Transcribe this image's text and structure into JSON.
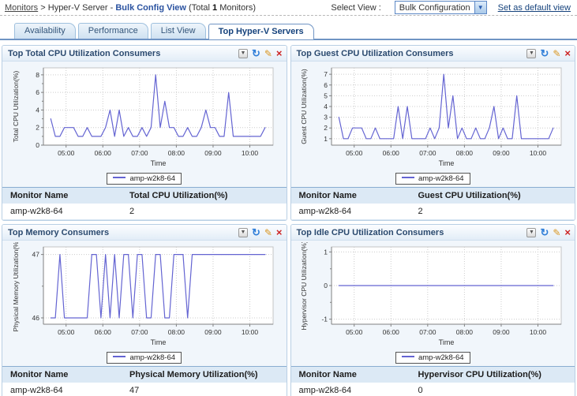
{
  "page": {
    "breadcrumb": {
      "link": "Monitors",
      "separator": ">",
      "context": "Hyper-V Server -",
      "view_name": "Bulk Config View",
      "total_prefix": "(Total",
      "total_count": "1",
      "total_suffix": "Monitors)"
    },
    "select_view_label": "Select View :",
    "select_view_value": "Bulk Configuration",
    "select_arrow": "▼",
    "set_default_link": "Set as default view"
  },
  "tabs": [
    {
      "label": "Availability",
      "active": false
    },
    {
      "label": "Performance",
      "active": false
    },
    {
      "label": "List View",
      "active": false
    },
    {
      "label": "Top Hyper-V Servers",
      "active": true
    }
  ],
  "panel_icons": {
    "minimize": "▼",
    "refresh": "↻",
    "edit": "✎",
    "close": "×"
  },
  "panels": [
    {
      "title": "Top Total CPU Utilization Consumers",
      "table": {
        "col1": "Monitor Name",
        "col2": "Total CPU Utilization(%)",
        "rows": [
          {
            "name": "amp-w2k8-64",
            "value": "2"
          }
        ]
      }
    },
    {
      "title": "Top Guest CPU Utilization Consumers",
      "table": {
        "col1": "Monitor Name",
        "col2": "Guest CPU Utilization(%)",
        "rows": [
          {
            "name": "amp-w2k8-64",
            "value": "2"
          }
        ]
      }
    },
    {
      "title": "Top Memory Consumers",
      "table": {
        "col1": "Monitor Name",
        "col2": "Physical Memory Utilization(%)",
        "rows": [
          {
            "name": "amp-w2k8-64",
            "value": "47"
          }
        ]
      }
    },
    {
      "title": "Top Idle CPU Utilization Consumers",
      "table": {
        "col1": "Monitor Name",
        "col2": "Hypervisor CPU Utilization(%)",
        "rows": [
          {
            "name": "amp-w2k8-64",
            "value": "0"
          }
        ]
      }
    }
  ],
  "chart_data": [
    {
      "type": "line",
      "title": "",
      "xlabel": "Time",
      "ylabel": "Total CPU Utilization(%)",
      "x_range_time": [
        "04:35",
        "10:25"
      ],
      "xlim_minutes": [
        263,
        638
      ],
      "x_ticks": [
        {
          "min": 300,
          "label": "05:00"
        },
        {
          "min": 360,
          "label": "06:00"
        },
        {
          "min": 420,
          "label": "07:00"
        },
        {
          "min": 480,
          "label": "08:00"
        },
        {
          "min": 540,
          "label": "09:00"
        },
        {
          "min": 600,
          "label": "10:00"
        }
      ],
      "ylim": [
        0,
        8.8
      ],
      "yticks": [
        0,
        2,
        4,
        6,
        8
      ],
      "yticks_minor": [
        1,
        3,
        5,
        7
      ],
      "grid": true,
      "legend_position": "bottom",
      "series": [
        {
          "name": "amp-w2k8-64",
          "color": "#6464d2",
          "x_start_min": 275,
          "x_step_min": 7.447,
          "values": [
            3,
            1,
            1,
            2,
            2,
            2,
            1,
            1,
            2,
            1,
            1,
            1,
            2,
            4,
            1,
            4,
            1,
            2,
            1,
            1,
            2,
            1,
            2,
            8,
            2,
            5,
            2,
            2,
            1,
            1,
            2,
            1,
            1,
            2,
            4,
            2,
            2,
            1,
            1,
            6,
            1,
            1,
            1,
            1,
            1,
            1,
            1,
            2
          ]
        }
      ]
    },
    {
      "type": "line",
      "title": "",
      "xlabel": "Time",
      "ylabel": "Guest CPU Utilization(%)",
      "x_range_time": [
        "04:35",
        "10:25"
      ],
      "xlim_minutes": [
        263,
        638
      ],
      "x_ticks": [
        {
          "min": 300,
          "label": "05:00"
        },
        {
          "min": 360,
          "label": "06:00"
        },
        {
          "min": 420,
          "label": "07:00"
        },
        {
          "min": 480,
          "label": "08:00"
        },
        {
          "min": 540,
          "label": "09:00"
        },
        {
          "min": 600,
          "label": "10:00"
        }
      ],
      "ylim": [
        0.4,
        7.6
      ],
      "yticks": [
        1,
        2,
        3,
        4,
        5,
        6,
        7
      ],
      "yticks_minor": [],
      "grid": true,
      "legend_position": "bottom",
      "series": [
        {
          "name": "amp-w2k8-64",
          "color": "#6464d2",
          "x_start_min": 275,
          "x_step_min": 7.447,
          "values": [
            3,
            1,
            1,
            2,
            2,
            2,
            1,
            1,
            2,
            1,
            1,
            1,
            1,
            4,
            1,
            4,
            1,
            1,
            1,
            1,
            2,
            1,
            2,
            7,
            2,
            5,
            1,
            2,
            1,
            1,
            2,
            1,
            1,
            2,
            4,
            1,
            2,
            1,
            1,
            5,
            1,
            1,
            1,
            1,
            1,
            1,
            1,
            2
          ]
        }
      ]
    },
    {
      "type": "line",
      "title": "",
      "xlabel": "Time",
      "ylabel": "Physical Memory Utilization(%)",
      "x_range_time": [
        "04:35",
        "10:25"
      ],
      "xlim_minutes": [
        263,
        638
      ],
      "x_ticks": [
        {
          "min": 300,
          "label": "05:00"
        },
        {
          "min": 360,
          "label": "06:00"
        },
        {
          "min": 420,
          "label": "07:00"
        },
        {
          "min": 480,
          "label": "08:00"
        },
        {
          "min": 540,
          "label": "09:00"
        },
        {
          "min": 600,
          "label": "10:00"
        }
      ],
      "ylim": [
        45.9,
        47.12
      ],
      "yticks": [
        46,
        47
      ],
      "yticks_minor": [
        46.5
      ],
      "grid": true,
      "legend_position": "bottom",
      "series": [
        {
          "name": "amp-w2k8-64",
          "color": "#6464d2",
          "x_start_min": 275,
          "x_step_min": 7.447,
          "values": [
            46,
            46,
            47,
            46,
            46,
            46,
            46,
            46,
            46,
            47,
            47,
            46,
            47,
            46,
            47,
            46,
            47,
            47,
            46,
            47,
            47,
            46,
            46,
            47,
            47,
            46,
            46,
            47,
            47,
            47,
            46,
            47,
            47,
            47,
            47,
            47,
            47,
            47,
            47,
            47,
            47,
            47,
            47,
            47,
            47,
            47,
            47,
            47
          ]
        }
      ]
    },
    {
      "type": "line",
      "title": "",
      "xlabel": "Time",
      "ylabel": "Hypervisor CPU Utilization(%)",
      "x_range_time": [
        "04:35",
        "10:25"
      ],
      "xlim_minutes": [
        263,
        638
      ],
      "x_ticks": [
        {
          "min": 300,
          "label": "05:00"
        },
        {
          "min": 360,
          "label": "06:00"
        },
        {
          "min": 420,
          "label": "07:00"
        },
        {
          "min": 480,
          "label": "08:00"
        },
        {
          "min": 540,
          "label": "09:00"
        },
        {
          "min": 600,
          "label": "10:00"
        }
      ],
      "ylim": [
        -1.15,
        1.15
      ],
      "yticks": [
        -1,
        0,
        1
      ],
      "yticks_minor": [
        -0.5,
        0.5
      ],
      "grid": true,
      "legend_position": "bottom",
      "series": [
        {
          "name": "amp-w2k8-64",
          "color": "#6464d2",
          "x_start_min": 275,
          "x_step_min": 7.447,
          "values": [
            0,
            0,
            0,
            0,
            0,
            0,
            0,
            0,
            0,
            0,
            0,
            0,
            0,
            0,
            0,
            0,
            0,
            0,
            0,
            0,
            0,
            0,
            0,
            0,
            0,
            0,
            0,
            0,
            0,
            0,
            0,
            0,
            0,
            0,
            0,
            0,
            0,
            0,
            0,
            0,
            0,
            0,
            0,
            0,
            0,
            0,
            0,
            0
          ]
        }
      ]
    }
  ]
}
